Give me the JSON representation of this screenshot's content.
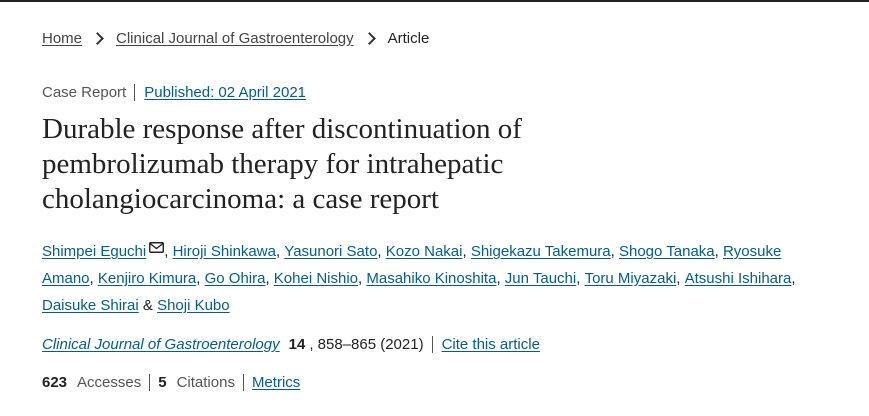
{
  "breadcrumb": {
    "home": "Home",
    "journal": "Clinical Journal of Gastroenterology",
    "current": "Article"
  },
  "meta": {
    "article_type": "Case Report",
    "published": "Published: 02 April 2021"
  },
  "title": "Durable response after discontinuation of pembrolizumab therapy for intrahepatic cholangiocarcinoma: a case report",
  "authors": [
    {
      "name": "Shimpei Eguchi",
      "sep": ", "
    },
    {
      "name": "Hiroji Shinkawa",
      "sep": ", "
    },
    {
      "name": "Yasunori Sato",
      "sep": ", "
    },
    {
      "name": "Kozo Nakai",
      "sep": ", "
    },
    {
      "name": "Shigekazu Takemura",
      "sep": ", "
    },
    {
      "name": "Shogo Tanaka",
      "sep": ", "
    },
    {
      "name": "Ryosuke Amano",
      "sep": ", "
    },
    {
      "name": "Kenjiro Kimura",
      "sep": ", "
    },
    {
      "name": "Go Ohira",
      "sep": ", "
    },
    {
      "name": "Kohei Nishio",
      "sep": ", "
    },
    {
      "name": "Masahiko Kinoshita",
      "sep": ", "
    },
    {
      "name": "Jun Tauchi",
      "sep": ", "
    },
    {
      "name": "Toru Miyazaki",
      "sep": ", "
    },
    {
      "name": "Atsushi Ishihara",
      "sep": ", "
    },
    {
      "name": "Daisuke Shirai",
      "sep": " & "
    },
    {
      "name": "Shoji Kubo",
      "sep": ""
    }
  ],
  "citation": {
    "journal": "Clinical Journal of Gastroenterology",
    "volume": "14",
    "pages": ", 858–865 (2021)",
    "cite_link": "Cite this article"
  },
  "metrics": {
    "accesses_count": "623",
    "accesses_label": "Accesses",
    "citations_count": "5",
    "citations_label": "Citations",
    "metrics_link": "Metrics"
  },
  "colors": {
    "link": "#025e8d",
    "text": "#222222",
    "muted": "#555555"
  }
}
